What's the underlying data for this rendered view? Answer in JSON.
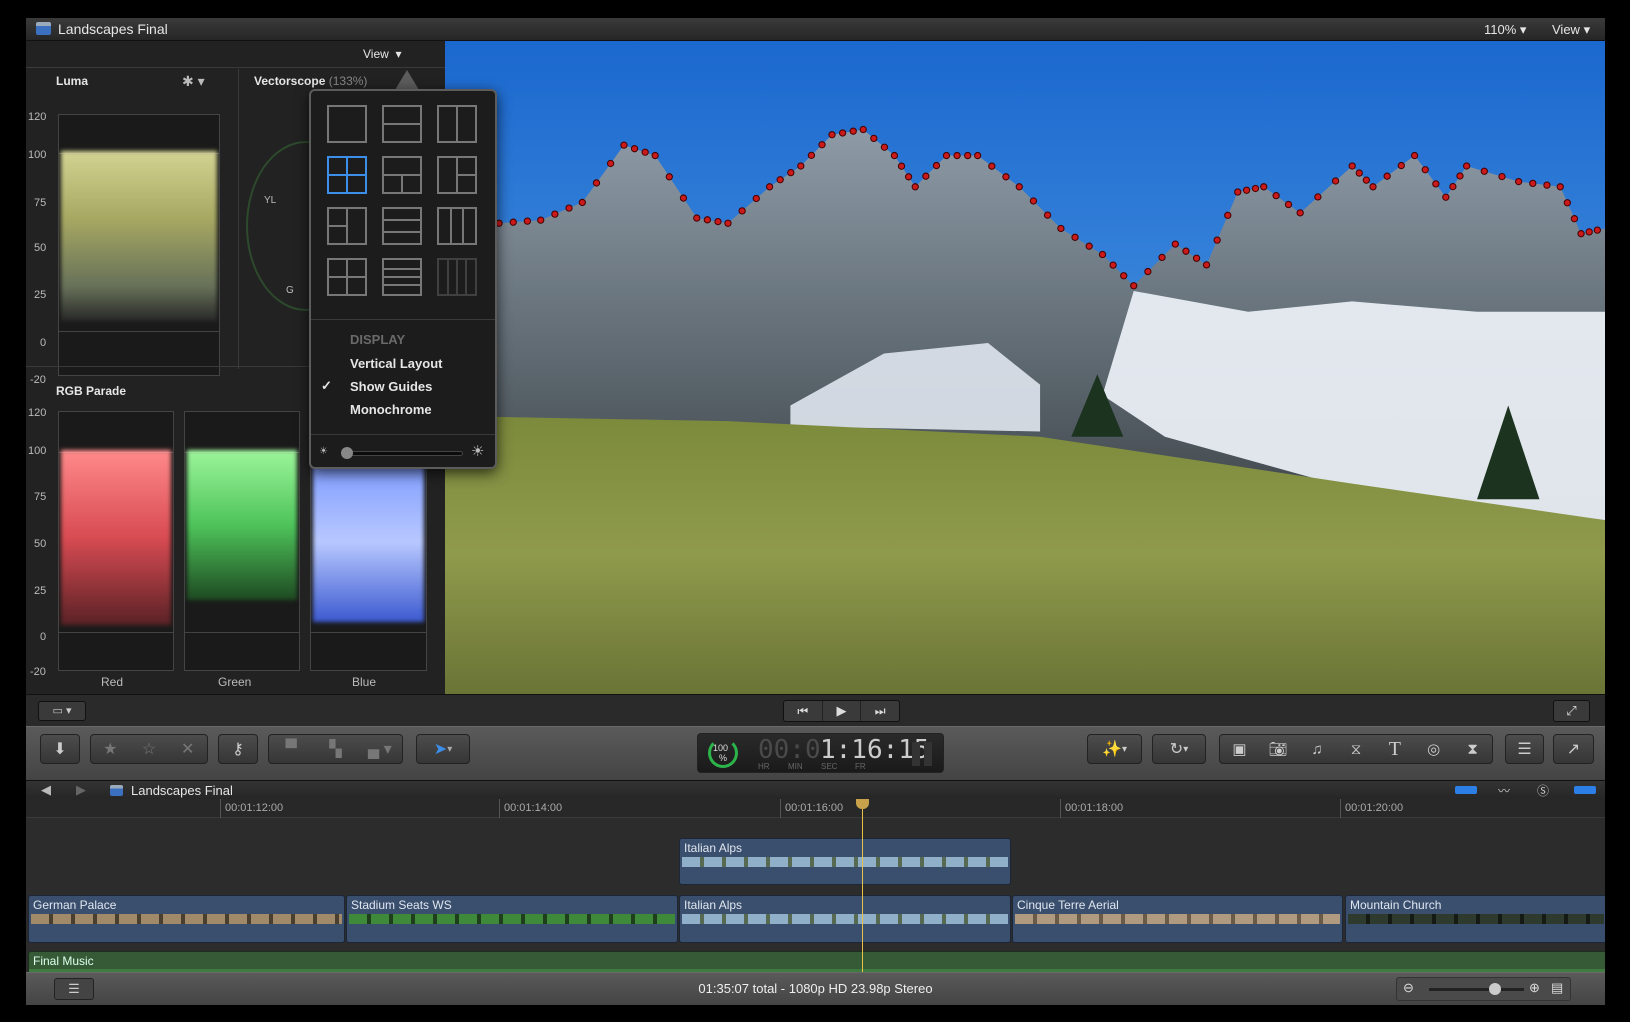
{
  "window": {
    "title": "Landscapes Final",
    "zoom": "110%",
    "view": "View"
  },
  "scopes": {
    "view_label": "View",
    "luma": {
      "title": "Luma",
      "axis": [
        "120",
        "100",
        "75",
        "50",
        "25",
        "0",
        "-20"
      ]
    },
    "vectorscope": {
      "title": "Vectorscope",
      "zoom": "(133%)",
      "labels": [
        "YL",
        "G"
      ]
    },
    "rgb_parade": {
      "title": "RGB Parade",
      "axis": [
        "120",
        "100",
        "75",
        "50",
        "25",
        "0",
        "-20"
      ],
      "channels": [
        "Red",
        "Green",
        "Blue"
      ]
    }
  },
  "view_menu": {
    "section": "DISPLAY",
    "items": [
      {
        "label": "Vertical Layout",
        "checked": false
      },
      {
        "label": "Show Guides",
        "checked": true
      },
      {
        "label": "Monochrome",
        "checked": false
      }
    ],
    "brightness": 0.0
  },
  "timecode": {
    "speed": "100",
    "pct": "%",
    "dim": "00:0",
    "value": "1:16:15",
    "units": [
      "HR",
      "MIN",
      "SEC",
      "FR"
    ]
  },
  "timeline": {
    "project": "Landscapes Final",
    "ruler": [
      "00:01:12:00",
      "00:01:14:00",
      "00:01:16:00",
      "00:01:18:00",
      "00:01:20:00"
    ],
    "connected": [
      {
        "name": "Italian Alps"
      }
    ],
    "primary": [
      {
        "name": "German Palace"
      },
      {
        "name": "Stadium Seats WS"
      },
      {
        "name": "Italian Alps"
      },
      {
        "name": "Cinque Terre Aerial"
      },
      {
        "name": "Mountain Church"
      }
    ],
    "audio": {
      "name": "Final Music"
    }
  },
  "status": "01:35:07 total - 1080p HD 23.98p Stereo",
  "colors": {
    "accent": "#3d8ee8",
    "clip": "#3a4f6e",
    "audio": "#3f7a3f",
    "playhead": "#e8c14a",
    "shape_dots": "#cc1a1a"
  }
}
